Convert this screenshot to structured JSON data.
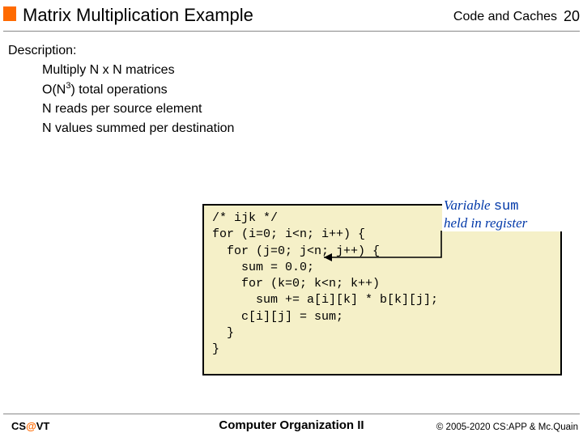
{
  "header": {
    "title": "Matrix Multiplication Example",
    "section": "Code and Caches",
    "page_number": "20"
  },
  "description": {
    "heading": "Description:",
    "items": [
      {
        "pre": "Multiply N x N matrices"
      },
      {
        "pre": "O(N",
        "sup": "3",
        "post": ") total operations"
      },
      {
        "pre": "N reads per source element"
      },
      {
        "pre": "N values summed per destination"
      }
    ]
  },
  "code": "/* ijk */\nfor (i=0; i<n; i++) {\n  for (j=0; j<n; j++) {\n    sum = 0.0;\n    for (k=0; k<n; k++)\n      sum += a[i][k] * b[k][j];\n    c[i][j] = sum;\n  }\n}",
  "annotation": {
    "line1_pre": "Variable ",
    "line1_code": "sum",
    "line2": "held in register"
  },
  "footer": {
    "brand_pre": "CS",
    "brand_at": "@",
    "brand_post": "VT",
    "course": "Computer Organization II",
    "copyright": "© 2005-2020  CS:APP & Mc.Quain"
  }
}
